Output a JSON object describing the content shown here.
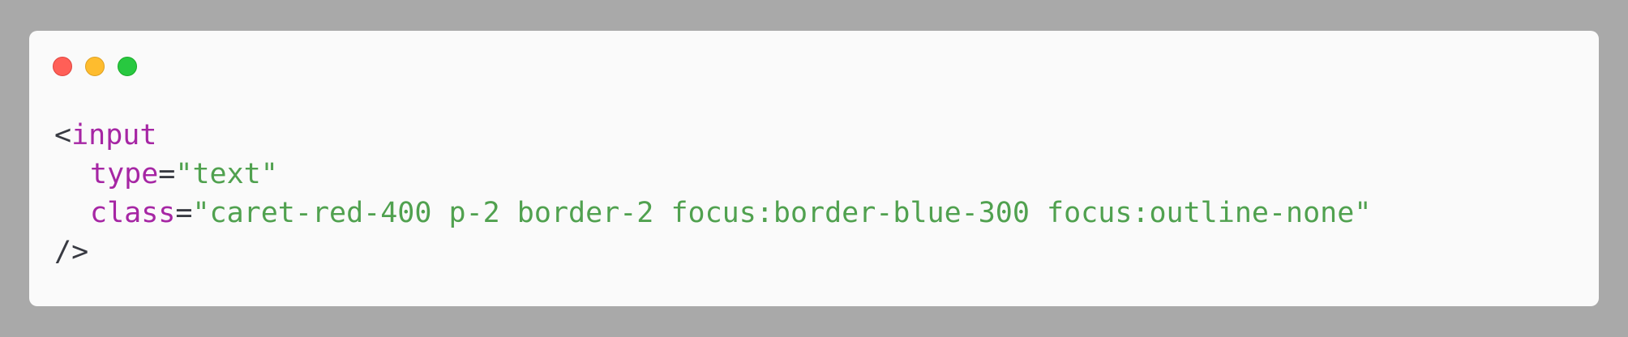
{
  "window_controls": [
    {
      "name": "close",
      "fill": "#ff5f57",
      "stroke": "#e0443e"
    },
    {
      "name": "minimize",
      "fill": "#febc2e",
      "stroke": "#dea123"
    },
    {
      "name": "zoom",
      "fill": "#28c840",
      "stroke": "#1aab29"
    }
  ],
  "colors": {
    "punctuation": "#383a42",
    "tag": "#a626a4",
    "attr": "#a626a4",
    "string": "#50a14f"
  },
  "code": {
    "open_bracket": "<",
    "tag_name": "input",
    "attr1_name": "type",
    "attr1_equals": "=",
    "attr1_value": "\"text\"",
    "attr2_name": "class",
    "attr2_equals": "=",
    "attr2_value": "\"caret-red-400 p-2 border-2 focus:border-blue-300 focus:outline-none\"",
    "close": "/>"
  }
}
